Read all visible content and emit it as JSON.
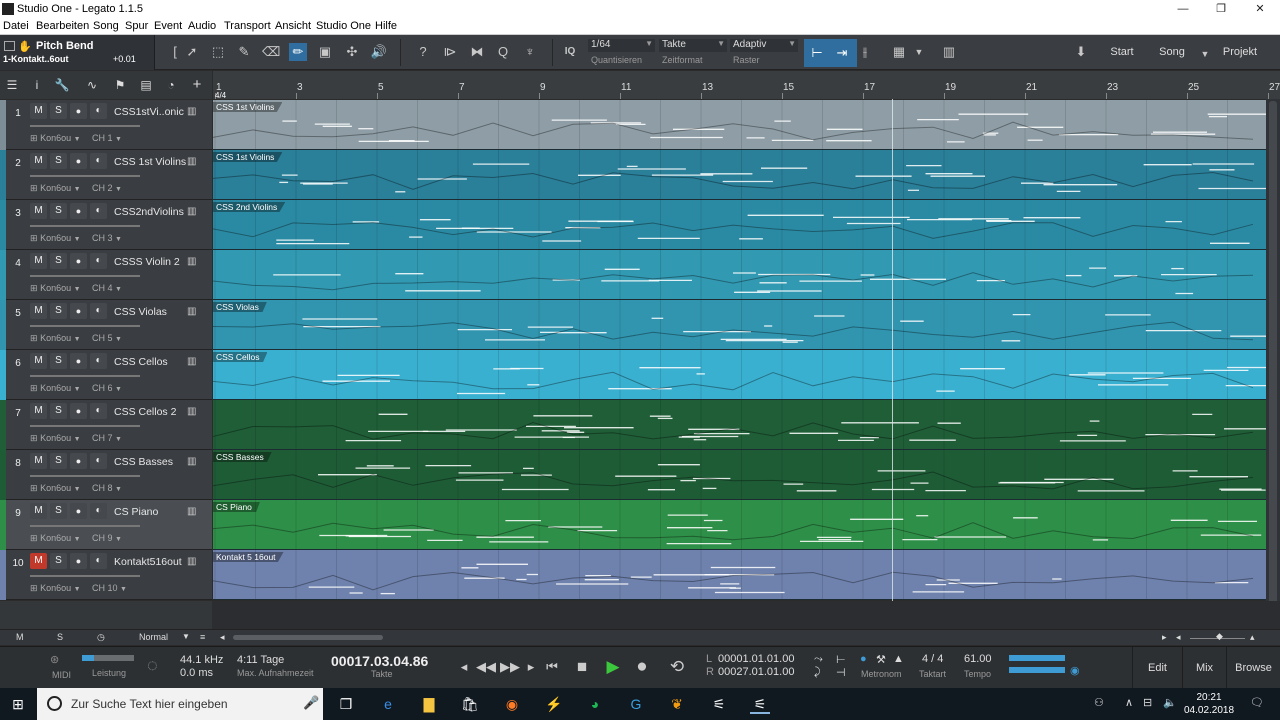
{
  "window": {
    "title": "Studio One - Legato 1.1.5",
    "controls": {
      "minimize": "—",
      "maximize": "❐",
      "close": "✕"
    }
  },
  "menu": [
    "Datei",
    "Bearbeiten",
    "Song",
    "Spur",
    "Event",
    "Audio",
    "Transport",
    "Ansicht",
    "Studio One",
    "Hilfe"
  ],
  "toolbar": {
    "info_name": "Pitch Bend",
    "info_sub": "1-Kontakt..6out",
    "info_value": "+0.01",
    "iq_label": "IQ",
    "quantize_value": "1/64",
    "quantize_label": "Quantisieren",
    "timeformat_value": "Takte",
    "timeformat_label": "Zeitformat",
    "snap_value": "Adaptiv",
    "snap_label": "Raster",
    "start_label": "Start",
    "song_label": "Song",
    "project_label": "Projekt"
  },
  "ruler": {
    "marks": [
      "1",
      "3",
      "5",
      "7",
      "9",
      "11",
      "13",
      "15",
      "17",
      "19",
      "21",
      "23",
      "25",
      "27"
    ],
    "signature": "4/4"
  },
  "tracks": [
    {
      "num": "1",
      "name": "CSS1stVi..onic",
      "inst": "Kon6ou",
      "ch": "CH 1",
      "clip": "CSS 1st Violins",
      "color": "#8f9ea6",
      "strip": "#7e8e96",
      "muted": false
    },
    {
      "num": "2",
      "name": "CSS 1st Violins",
      "inst": "Kon6ou",
      "ch": "CH 2",
      "clip": "CSS 1st Violins",
      "color": "#2a7f99",
      "strip": "#2a7f99",
      "muted": false
    },
    {
      "num": "3",
      "name": "CSS2ndViolins",
      "inst": "Kon6ou",
      "ch": "CH 3",
      "clip": "CSS 2nd Violins",
      "color": "#2b8aa3",
      "strip": "#2b8aa3",
      "muted": false
    },
    {
      "num": "4",
      "name": "CSSS Violin 2",
      "inst": "Kon6ou",
      "ch": "CH 4",
      "clip": "",
      "color": "#3299b2",
      "strip": "#3299b2",
      "muted": false
    },
    {
      "num": "5",
      "name": "CSS Violas",
      "inst": "Kon6ou",
      "ch": "CH 5",
      "clip": "CSS Violas",
      "color": "#3195b0",
      "strip": "#3195b0",
      "muted": false
    },
    {
      "num": "6",
      "name": "CSS Cellos",
      "inst": "Kon6ou",
      "ch": "CH 6",
      "clip": "CSS Cellos",
      "color": "#3ab0d0",
      "strip": "#3ab0d0",
      "muted": false
    },
    {
      "num": "7",
      "name": "CSS Cellos 2",
      "inst": "Kon6ou",
      "ch": "CH 7",
      "clip": "",
      "color": "#1f5e37",
      "strip": "#1f5e37",
      "muted": false
    },
    {
      "num": "8",
      "name": "CSS Basses",
      "inst": "Kon6ou",
      "ch": "CH 8",
      "clip": "CSS Basses",
      "color": "#1e5c36",
      "strip": "#1e5c36",
      "muted": false
    },
    {
      "num": "9",
      "name": "CS Piano",
      "inst": "Kon6ou",
      "ch": "CH 9",
      "clip": "CS Piano",
      "color": "#2e8f48",
      "strip": "#2e8f48",
      "muted": false
    },
    {
      "num": "10",
      "name": "Kontakt516out",
      "inst": "Kon6ou",
      "ch": "CH 10",
      "clip": "Kontakt 5 16out",
      "color": "#6f82ad",
      "strip": "#6f82ad",
      "muted": true
    }
  ],
  "track_buttons": {
    "mute": "M",
    "solo": "S"
  },
  "bottom_strip": {
    "m": "M",
    "s": "S",
    "mode": "Normal"
  },
  "transport": {
    "midi_label": "MIDI",
    "perf_label": "Leistung",
    "samplerate": "44.1 kHz",
    "latency": "0.0 ms",
    "rectime": "4:11 Tage",
    "rectime_label": "Max. Aufnahmezeit",
    "position": "00017.03.04.86",
    "position_label": "Takte",
    "loop_l_label": "L",
    "loop_l": "00001.01.01.00",
    "loop_r_label": "R",
    "loop_r": "00027.01.01.00",
    "metronome_label": "Metronom",
    "timesig": "4 / 4",
    "timesig_label": "Taktart",
    "tempo": "61.00",
    "tempo_label": "Tempo",
    "edit_label": "Edit",
    "mix_label": "Mix",
    "browse_label": "Browse"
  },
  "taskbar": {
    "search_placeholder": "Zur Suche Text hier eingeben",
    "time": "20:21",
    "date": "04.02.2018"
  }
}
